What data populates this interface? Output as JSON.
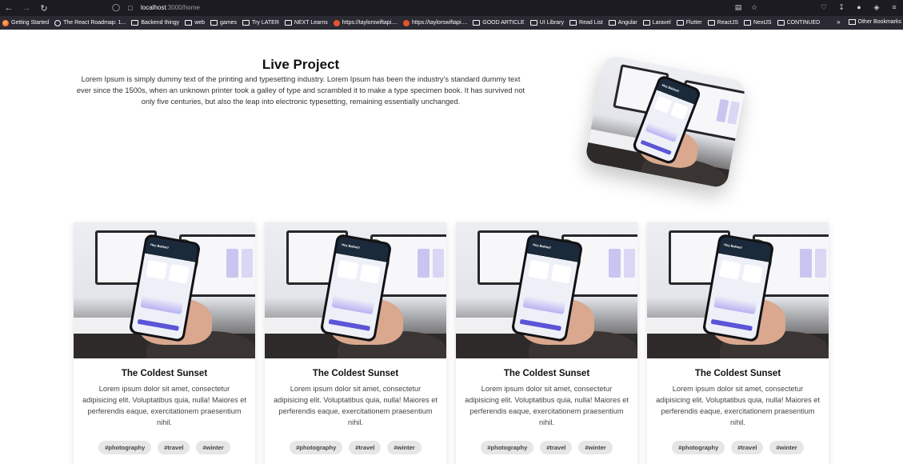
{
  "browser": {
    "url_host": "localhost",
    "url_path": ":3000/home",
    "bookmarks": [
      {
        "label": "Getting Started",
        "icon": "firefox-icon"
      },
      {
        "label": "The React Roadmap: 1...",
        "icon": "globe-icon"
      },
      {
        "label": "Backend thingy",
        "icon": "folder-icon"
      },
      {
        "label": "web",
        "icon": "folder-icon"
      },
      {
        "label": "games",
        "icon": "folder-icon"
      },
      {
        "label": "Try LATER",
        "icon": "folder-icon"
      },
      {
        "label": "NEXT Learns",
        "icon": "folder-icon"
      },
      {
        "label": "https://taylorswiftapi....",
        "icon": "site-icon"
      },
      {
        "label": "https://taylorswiftapi....",
        "icon": "site-icon"
      },
      {
        "label": "GOOD ARTICLE",
        "icon": "folder-icon"
      },
      {
        "label": "UI Library",
        "icon": "folder-icon"
      },
      {
        "label": "Read List",
        "icon": "folder-icon"
      },
      {
        "label": "Angular",
        "icon": "folder-icon"
      },
      {
        "label": "Laravel",
        "icon": "folder-icon"
      },
      {
        "label": "Flutter",
        "icon": "folder-icon"
      },
      {
        "label": "ReactJS",
        "icon": "folder-icon"
      },
      {
        "label": "NextJS",
        "icon": "folder-icon"
      },
      {
        "label": "CONTINUED",
        "icon": "folder-icon"
      }
    ],
    "other_bookmarks": "Other Bookmarks"
  },
  "hero": {
    "title": "Live Project",
    "description": "Lorem Ipsum is simply dummy text of the printing and typesetting industry. Lorem Ipsum has been the industry's standard dummy text ever since the 1500s, when an unknown printer took a galley of type and scrambled it to make a type specimen book. It has survived not only five centuries, but also the leap into electronic typesetting, remaining essentially unchanged."
  },
  "phone_greeting": "Hey Bakket!",
  "cards": [
    {
      "title": "The Coldest Sunset",
      "description": "Lorem ipsum dolor sit amet, consectetur adipisicing elit. Voluptatibus quia, nulla! Maiores et perferendis eaque, exercitationem praesentium nihil.",
      "tags": [
        "#photography",
        "#travel",
        "#winter"
      ]
    },
    {
      "title": "The Coldest Sunset",
      "description": "Lorem ipsum dolor sit amet, consectetur adipisicing elit. Voluptatibus quia, nulla! Maiores et perferendis eaque, exercitationem praesentium nihil.",
      "tags": [
        "#photography",
        "#travel",
        "#winter"
      ]
    },
    {
      "title": "The Coldest Sunset",
      "description": "Lorem ipsum dolor sit amet, consectetur adipisicing elit. Voluptatibus quia, nulla! Maiores et perferendis eaque, exercitationem praesentium nihil.",
      "tags": [
        "#photography",
        "#travel",
        "#winter"
      ]
    },
    {
      "title": "The Coldest Sunset",
      "description": "Lorem ipsum dolor sit amet, consectetur adipisicing elit. Voluptatibus quia, nulla! Maiores et perferendis eaque, exercitationem praesentium nihil.",
      "tags": [
        "#photography",
        "#travel",
        "#winter"
      ]
    }
  ]
}
